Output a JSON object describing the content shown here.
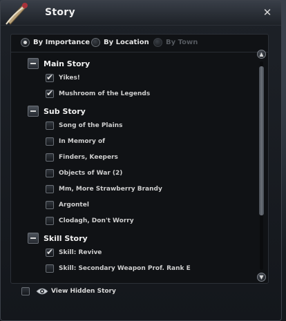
{
  "window": {
    "title": "Story",
    "close_glyph": "✕"
  },
  "sort": {
    "options": [
      {
        "label": "By Importance",
        "selected": true,
        "enabled": true
      },
      {
        "label": "By Location",
        "selected": false,
        "enabled": true
      },
      {
        "label": "By Town",
        "selected": false,
        "enabled": false
      }
    ]
  },
  "categories": [
    {
      "label": "Main Story",
      "items": [
        {
          "label": "Yikes!",
          "checked": true
        },
        {
          "label": "Mushroom of the Legends",
          "checked": true
        }
      ]
    },
    {
      "label": "Sub Story",
      "items": [
        {
          "label": "Song of the Plains",
          "checked": false
        },
        {
          "label": "In Memory of",
          "checked": false
        },
        {
          "label": "Finders, Keepers",
          "checked": false
        },
        {
          "label": "Objects of War (2)",
          "checked": false
        },
        {
          "label": "Mm, More Strawberry Brandy",
          "checked": false
        },
        {
          "label": "Argontel",
          "checked": false
        },
        {
          "label": "Clodagh, Don't Worry",
          "checked": false
        }
      ]
    },
    {
      "label": "Skill Story",
      "items": [
        {
          "label": "Skill: Revive",
          "checked": true
        },
        {
          "label": "Skill: Secondary Weapon Prof. Rank E",
          "checked": false
        }
      ]
    }
  ],
  "footer": {
    "view_hidden_label": "View Hidden Story",
    "checked": false
  },
  "icons": {
    "title": "scroll-quill-icon",
    "scroll_up": "chevron-up-icon",
    "scroll_down": "chevron-down-icon",
    "view_hidden": "eye-icon"
  },
  "colors": {
    "text": "#dcdcdc",
    "panel": "#101215",
    "window": "#1c2026"
  }
}
